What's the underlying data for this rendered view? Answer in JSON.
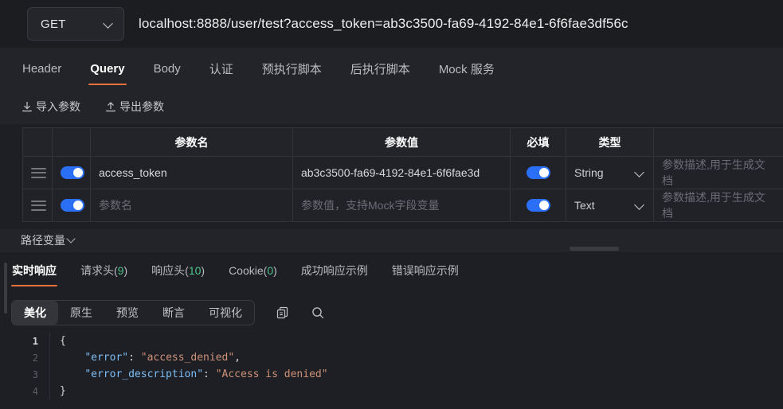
{
  "urlbar": {
    "method": "GET",
    "url": "localhost:8888/user/test?access_token=ab3c3500-fa69-4192-84e1-6f6fae3df56c"
  },
  "request_tabs": [
    {
      "label": "Header",
      "active": false
    },
    {
      "label": "Query",
      "active": true
    },
    {
      "label": "Body",
      "active": false
    },
    {
      "label": "认证",
      "active": false
    },
    {
      "label": "预执行脚本",
      "active": false
    },
    {
      "label": "后执行脚本",
      "active": false
    },
    {
      "label": "Mock 服务",
      "active": false
    }
  ],
  "io_actions": [
    {
      "label": "导入参数",
      "icon": "import-icon"
    },
    {
      "label": "导出参数",
      "icon": "export-icon"
    }
  ],
  "param_table": {
    "headers": [
      "",
      "",
      "参数名",
      "参数值",
      "必填",
      "类型",
      ""
    ],
    "rows": [
      {
        "enabled": true,
        "name": "access_token",
        "name_placeholder": "参数名",
        "name_is_placeholder": false,
        "value": "ab3c3500-fa69-4192-84e1-6f6fae3d",
        "value_placeholder": "参数值，支持Mock字段变量",
        "value_is_placeholder": false,
        "required": true,
        "type": "String",
        "desc": "",
        "desc_placeholder": "参数描述,用于生成文档"
      },
      {
        "enabled": true,
        "name": "",
        "name_placeholder": "参数名",
        "name_is_placeholder": true,
        "value": "",
        "value_placeholder": "参数值，支持Mock字段变量",
        "value_is_placeholder": true,
        "required": true,
        "type": "Text",
        "desc": "",
        "desc_placeholder": "参数描述,用于生成文档"
      }
    ]
  },
  "path_variable": {
    "label": "路径变量"
  },
  "response_tabs": [
    {
      "label": "实时响应",
      "count": "",
      "active": true
    },
    {
      "label": "请求头",
      "count": "9",
      "active": false
    },
    {
      "label": "响应头",
      "count": "10",
      "active": false
    },
    {
      "label": "Cookie",
      "count": "0",
      "active": false
    },
    {
      "label": "成功响应示例",
      "count": "",
      "active": false
    },
    {
      "label": "错误响应示例",
      "count": "",
      "active": false
    }
  ],
  "viewer": {
    "segments": [
      {
        "label": "美化",
        "active": true
      },
      {
        "label": "原生",
        "active": false
      },
      {
        "label": "预览",
        "active": false
      },
      {
        "label": "断言",
        "active": false
      },
      {
        "label": "可视化",
        "active": false
      }
    ],
    "copy_icon": "copy-icon",
    "search_icon": "search-icon"
  },
  "code": {
    "lines": [
      {
        "no": "1",
        "tokens": [
          {
            "t": "{",
            "c": "p"
          }
        ]
      },
      {
        "no": "2",
        "tokens": [
          {
            "t": "    ",
            "c": "p"
          },
          {
            "t": "\"error\"",
            "c": "k"
          },
          {
            "t": ": ",
            "c": "p"
          },
          {
            "t": "\"access_denied\"",
            "c": "s"
          },
          {
            "t": ",",
            "c": "p"
          }
        ]
      },
      {
        "no": "3",
        "tokens": [
          {
            "t": "    ",
            "c": "p"
          },
          {
            "t": "\"error_description\"",
            "c": "k"
          },
          {
            "t": ": ",
            "c": "p"
          },
          {
            "t": "\"Access is denied\"",
            "c": "s"
          }
        ]
      },
      {
        "no": "4",
        "tokens": [
          {
            "t": "}",
            "c": "p"
          }
        ]
      }
    ]
  },
  "colors": {
    "accent_orange": "#e8703a",
    "toggle_blue": "#2a6ff5",
    "count_green": "#4ec28a",
    "json_key": "#7dbef5",
    "json_string": "#ce9178",
    "background": "#1e1f24",
    "panel": "#232429"
  }
}
